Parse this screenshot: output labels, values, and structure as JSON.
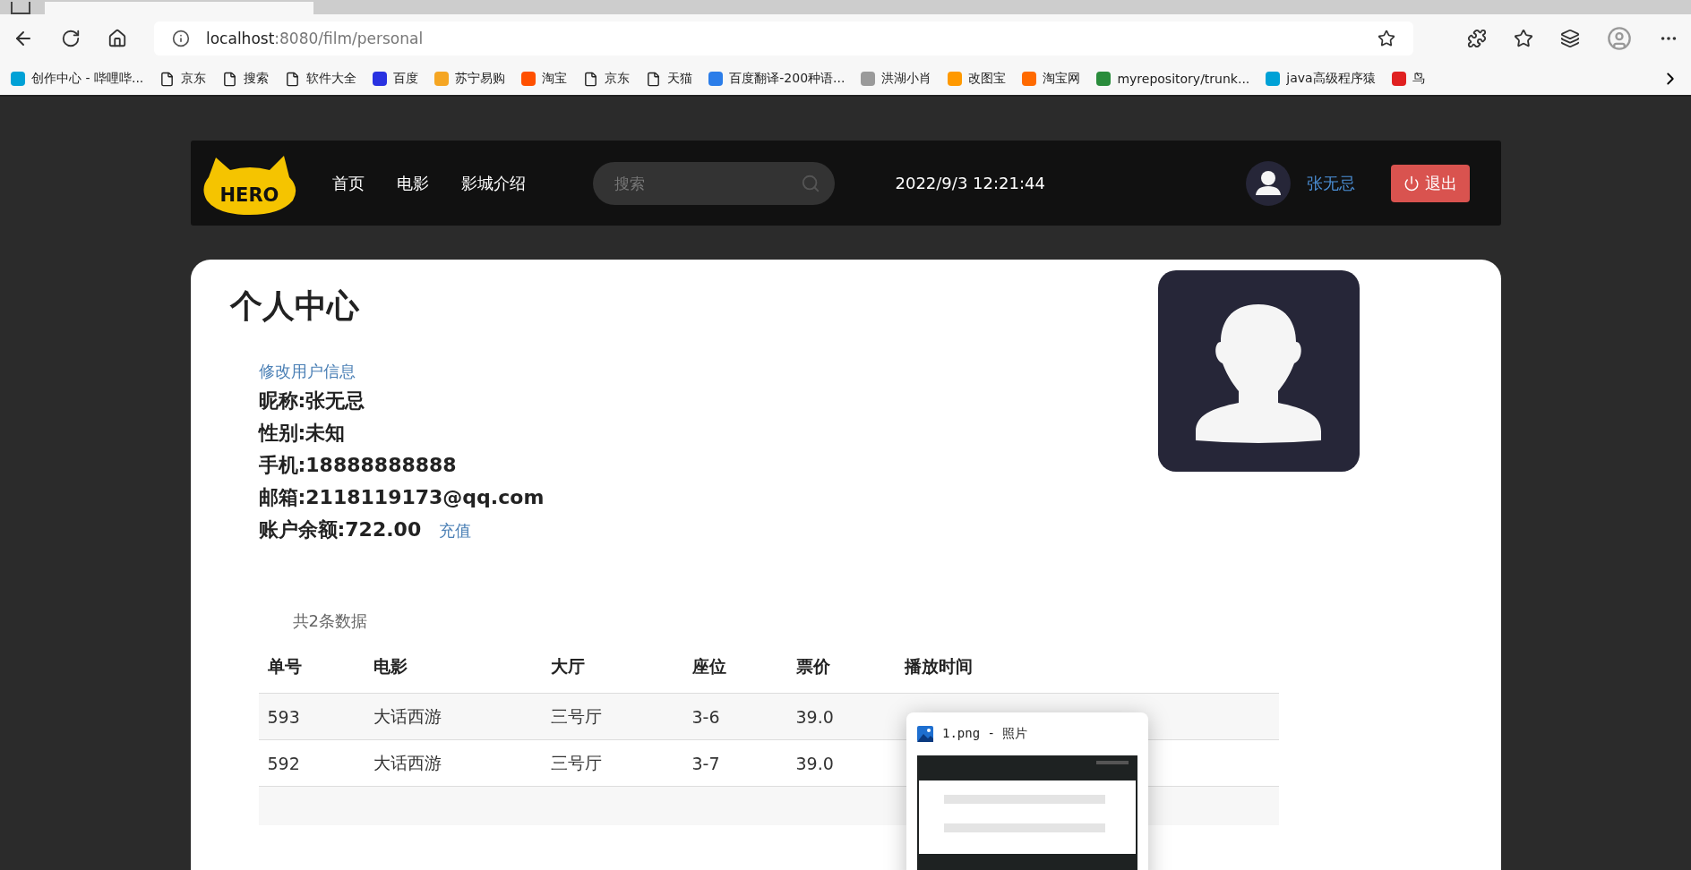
{
  "browser": {
    "url_host": "localhost",
    "url_rest": ":8080/film/personal",
    "bookmarks": [
      {
        "label": "创作中心 - 哔哩哔...",
        "kind": "site",
        "color": "#00a1d6"
      },
      {
        "label": "京东",
        "kind": "page"
      },
      {
        "label": "搜索",
        "kind": "page"
      },
      {
        "label": "软件大全",
        "kind": "page"
      },
      {
        "label": "百度",
        "kind": "site",
        "color": "#2932e1"
      },
      {
        "label": "苏宁易购",
        "kind": "site",
        "color": "#f5a623"
      },
      {
        "label": "淘宝",
        "kind": "site",
        "color": "#ff5000"
      },
      {
        "label": "京东",
        "kind": "page"
      },
      {
        "label": "天猫",
        "kind": "page"
      },
      {
        "label": "百度翻译-200种语...",
        "kind": "site",
        "color": "#2b7de9"
      },
      {
        "label": "洪湖小肖",
        "kind": "site",
        "color": "#9a9a9a"
      },
      {
        "label": "改图宝",
        "kind": "site",
        "color": "#ff9900"
      },
      {
        "label": "淘宝网",
        "kind": "site",
        "color": "#ff6a00"
      },
      {
        "label": "myrepository/trunk...",
        "kind": "site",
        "color": "#2a8c3c"
      },
      {
        "label": "java高级程序猿",
        "kind": "site",
        "color": "#00a1d6"
      },
      {
        "label": "鸟",
        "kind": "site",
        "color": "#e02020"
      }
    ]
  },
  "navbar": {
    "logo": "HERO",
    "links": [
      "首页",
      "电影",
      "影城介绍"
    ],
    "search": {
      "placeholder": "搜索"
    },
    "datetime": "2022/9/3 12:21:44",
    "username": "张无忌",
    "logout": "退出"
  },
  "profile": {
    "title": "个人中心",
    "edit_link": "修改用户信息",
    "fields": [
      "昵称:张无忌",
      "性别:未知",
      "手机:18888888888",
      "邮箱:2118119173@qq.com"
    ],
    "balance": "账户余额:722.00",
    "recharge_link": "充值"
  },
  "orders": {
    "count": "共2条数据",
    "columns": [
      "单号",
      "电影",
      "大厅",
      "座位",
      "票价",
      "播放时间"
    ],
    "rows": [
      [
        "593",
        "大话西游",
        "三号厅",
        "3-6",
        "39.0"
      ],
      [
        "592",
        "大话西游",
        "三号厅",
        "3-7",
        "39.0"
      ]
    ]
  },
  "preview_popup": {
    "title": "1.png - 照片"
  }
}
